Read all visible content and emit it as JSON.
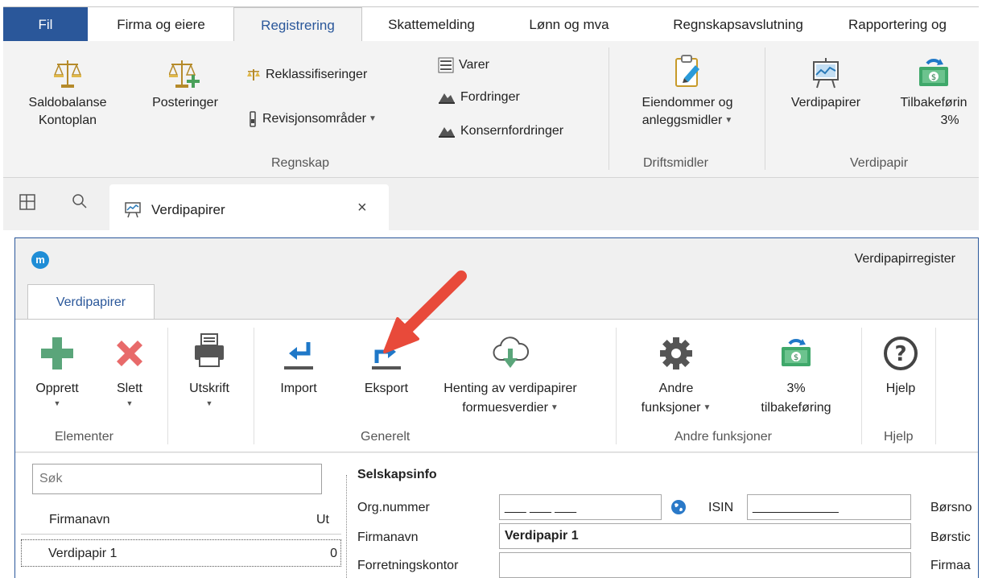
{
  "menu": {
    "tabs": [
      "Fil",
      "Firma og eiere",
      "Registrering",
      "Skattemelding",
      "Lønn og mva",
      "Regnskapsavslutning",
      "Rapportering og"
    ],
    "active_tab": "Registrering"
  },
  "ribbon": {
    "saldobalanse": [
      "Saldobalanse",
      "Kontoplan"
    ],
    "posteringer": "Posteringer",
    "reklassifiseringer": "Reklassifiseringer",
    "revisjonsomrader": "Revisjonsområder",
    "varer": "Varer",
    "fordringer": "Fordringer",
    "konsernfordringer": "Konsernfordringer",
    "regnskap_group": "Regnskap",
    "eiendommer": [
      "Eiendommer og",
      "anleggsmidler"
    ],
    "driftsmidler_group": "Driftsmidler",
    "verdipapirer": "Verdipapirer",
    "tilbakeforing": [
      "Tilbakeførin",
      "3%"
    ],
    "verdipapir_group": "Verdipapir"
  },
  "doc_tab": {
    "label": "Verdipapirer",
    "close": "×"
  },
  "window": {
    "title": "Verdipapirregister",
    "logo": "m",
    "tab": "Verdipapirer",
    "buttons": {
      "opprett": "Opprett",
      "slett": "Slett",
      "utskrift": "Utskrift",
      "import": "Import",
      "eksport": "Eksport",
      "henting": [
        "Henting av verdipapirer",
        "formuesverdier"
      ],
      "andre": [
        "Andre",
        "funksjoner"
      ],
      "tilbake": [
        "3%",
        "tilbakeføring"
      ],
      "hjelp": "Hjelp"
    },
    "groups": {
      "elementer": "Elementer",
      "generelt": "Generelt",
      "andre": "Andre funksjoner",
      "hjelp": "Hjelp"
    }
  },
  "list": {
    "search_placeholder": "Søk",
    "columns": [
      "Firmanavn",
      "Ut"
    ],
    "rows": [
      {
        "name": "Verdipapir 1",
        "value": "0"
      }
    ]
  },
  "form": {
    "section": "Selskapsinfo",
    "org_label": "Org.nummer",
    "org_value": "___ ___ ___",
    "isin_label": "ISIN",
    "isin_value": "____________",
    "firmanavn_label": "Firmanavn",
    "firmanavn_value": "Verdipapir 1",
    "forretning_label": "Forretningskontor",
    "right_labels": [
      "Børsno",
      "Børstic",
      "Firmaa"
    ]
  },
  "colors": {
    "brand": "#2a579a",
    "accent_arrow": "#e84a3a",
    "green": "#5aa57a",
    "red": "#e86a6a"
  }
}
